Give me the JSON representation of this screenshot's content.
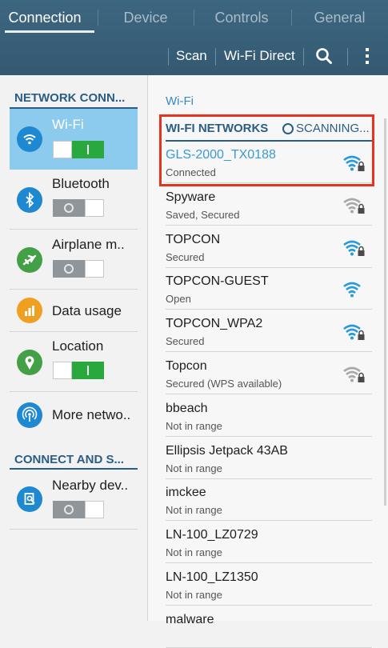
{
  "tabs": [
    {
      "label": "Connection",
      "active": true
    },
    {
      "label": "Device",
      "active": false
    },
    {
      "label": "Controls",
      "active": false
    },
    {
      "label": "General",
      "active": false
    }
  ],
  "toolbar": {
    "scan_label": "Scan",
    "wifi_direct_label": "Wi-Fi Direct",
    "icons": [
      "search-icon",
      "more-vert-icon"
    ]
  },
  "left_panel": {
    "section1_title": "NETWORK CONN...",
    "section2_title": "CONNECT AND S...",
    "items": [
      {
        "label": "Wi-Fi",
        "icon": "wifi-icon",
        "icon_color": "#1e88d0",
        "toggle": "on",
        "selected": true
      },
      {
        "label": "Bluetooth",
        "icon": "bluetooth-icon",
        "icon_color": "#1e88d0",
        "toggle": "off"
      },
      {
        "label": "Airplane m..",
        "icon": "airplane-icon",
        "icon_color": "#43a047",
        "toggle": "off"
      },
      {
        "label": "Data usage",
        "icon": "data-usage-icon",
        "icon_color": "#f0a020"
      },
      {
        "label": "Location",
        "icon": "location-icon",
        "icon_color": "#43a047",
        "toggle": "on"
      },
      {
        "label": "More netwo..",
        "icon": "more-networks-icon",
        "icon_color": "#1e88d0"
      },
      {
        "label": "Nearby dev..",
        "icon": "nearby-devices-icon",
        "icon_color": "#1e88d0",
        "toggle": "off"
      }
    ]
  },
  "right_panel": {
    "caption": "Wi-Fi",
    "networks_title": "WI-FI NETWORKS",
    "scanning_label": "SCANNING...",
    "networks": [
      {
        "name": "GLS-2000_TX0188",
        "status": "Connected",
        "signal": "strong",
        "locked": true,
        "connected": true
      },
      {
        "name": "Spyware",
        "status": "Saved, Secured",
        "signal": "weak",
        "locked": true
      },
      {
        "name": "TOPCON",
        "status": "Secured",
        "signal": "strong",
        "locked": true
      },
      {
        "name": "TOPCON-GUEST",
        "status": "Open",
        "signal": "strong",
        "locked": false
      },
      {
        "name": "TOPCON_WPA2",
        "status": "Secured",
        "signal": "strong",
        "locked": true
      },
      {
        "name": "Topcon",
        "status": "Secured (WPS available)",
        "signal": "weak",
        "locked": true
      },
      {
        "name": "bbeach",
        "status": "Not in range"
      },
      {
        "name": "Ellipsis Jetpack 43AB",
        "status": "Not in range"
      },
      {
        "name": "imckee",
        "status": "Not in range"
      },
      {
        "name": "LN-100_LZ0729",
        "status": "Not in range"
      },
      {
        "name": "LN-100_LZ1350",
        "status": "Not in range"
      },
      {
        "name": "malware",
        "status": ""
      }
    ]
  },
  "colors": {
    "header": "#3a627b",
    "accent": "#2a5d85",
    "selected": "#8dcbee",
    "toggle_on": "#29a83e",
    "highlight_box": "#e4341f",
    "wifi_strong": "#2a9ad8",
    "wifi_weak": "#a8a8a8"
  }
}
